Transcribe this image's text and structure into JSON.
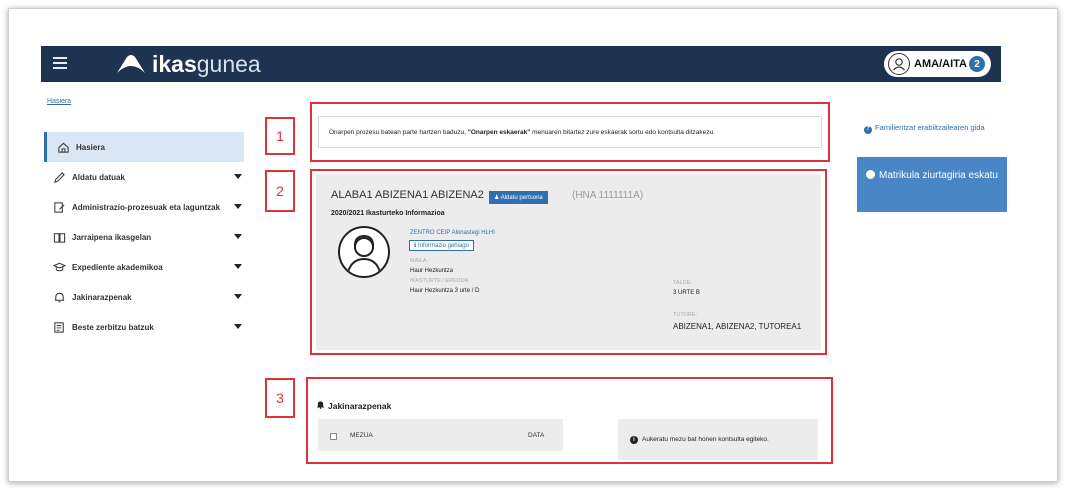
{
  "header": {
    "brand_bold": "ikas",
    "brand_light": "gunea",
    "user_label": "AMA/AITA",
    "user_badge": "2"
  },
  "breadcrumb": "Hasiera",
  "sidebar": {
    "items": [
      {
        "label": "Hasiera",
        "icon": "home-icon"
      },
      {
        "label": "Aldatu datuak",
        "icon": "pencil-icon"
      },
      {
        "label": "Administrazio-prozesuak eta laguntzak",
        "icon": "document-edit-icon"
      },
      {
        "label": "Jarraipena ikasgelan",
        "icon": "book-icon"
      },
      {
        "label": "Expediente akademikoa",
        "icon": "graduation-cap-icon"
      },
      {
        "label": "Jakinarazpenak",
        "icon": "bell-icon"
      },
      {
        "label": "Beste zerbitzu batzuk",
        "icon": "services-icon"
      }
    ]
  },
  "markers": [
    "1",
    "2",
    "3"
  ],
  "notice": {
    "text_before": "Onarpen prozesu batean parte hartzen baduzu, ",
    "text_bold": "\"Onarpen eskaerak\"",
    "text_after": " menuaren bitartez zure eskaerak sortu edo kontsulta ditzakezu."
  },
  "student": {
    "name": "ALABA1 ABIZENA1 ABIZENA2",
    "edit_button": "Aldatu pertsona",
    "hna": "(HNA 1111111A)",
    "year_info": "2020/2021 Ikasturteko Informazioa",
    "school": "ZENTRO CEIP Alonastegi HLHI",
    "more_info": "Informazio gehiago",
    "maila_label": "MAILA :",
    "maila_value": "Haur Hezkuntza",
    "ikasturte_label": "IKASTURTE / EREDUA",
    "ikasturte_value": "Haur Hezkuntza 3 urte  /  D",
    "talde_label": "TALDE:",
    "talde_value": "3 URTE B",
    "tutore_label": "TUTORE:",
    "tutore_value": "ABIZENA1, ABIZENA2, TUTOREA1"
  },
  "notifications": {
    "title": "Jakinarazpenak",
    "col_message": "MEZUA",
    "col_date": "DATA",
    "info_text": "Aukeratu mezu bat honen kontsulta egiteko."
  },
  "right": {
    "guide_link": "Familientzat erabiltzailearen gida",
    "enroll_button": "Matrikula ziurtagiria eskatu"
  },
  "colors": {
    "topbar": "#1e3350",
    "accent": "#2f6fb0",
    "highlight": "#e0303b"
  }
}
